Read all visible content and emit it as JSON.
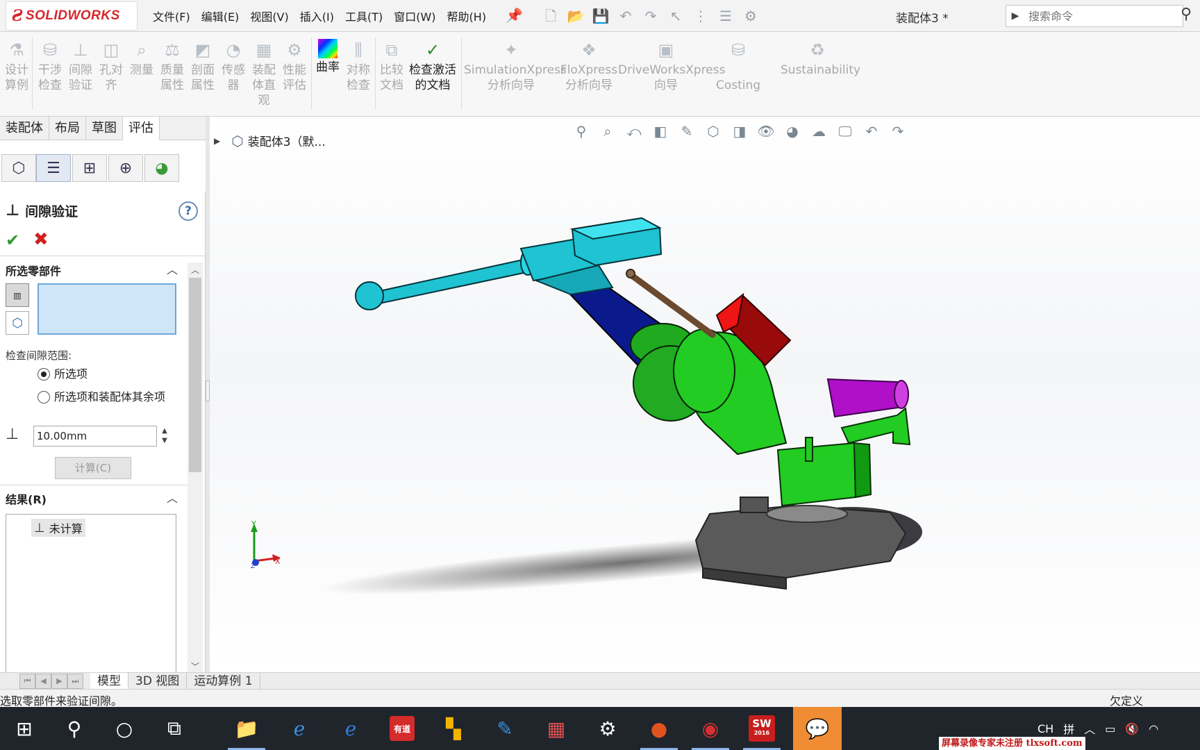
{
  "app": {
    "brand_ds": "Ƨ",
    "brand_name": "SOLIDWORKS",
    "doc_title": "装配体3 *"
  },
  "menu": [
    "文件(F)",
    "编辑(E)",
    "视图(V)",
    "插入(I)",
    "工具(T)",
    "窗口(W)",
    "帮助(H)"
  ],
  "search": {
    "placeholder": "搜索命令"
  },
  "ribbon": {
    "design_study": "设计\n算例",
    "interference": "干涉\n检查",
    "clearance": "间隙\n验证",
    "hole_align": "孔对\n齐",
    "measure": "测量",
    "mass_props": "质量\n属性",
    "section_props": "剖面\n属性",
    "sensor": "传感\n器",
    "asm_visual": "装配\n体直\n观",
    "perf_eval": "性能\n评估",
    "curvature": "曲率",
    "symmetry": "对称\n检查",
    "compare": "比较\n文档",
    "check_active": "检查激活\n的文档",
    "simxpress": "SimulationXpress\n分析向导",
    "floxpress": "FloXpress\n分析向导",
    "driveworks": "DriveWorksXpress\n向导",
    "costing": "Costing",
    "sustainability": "Sustainability"
  },
  "tabs": [
    "装配体",
    "布局",
    "草图",
    "评估"
  ],
  "property_manager": {
    "title": "间隙验证",
    "help": "?",
    "ok": "✔",
    "cancel": "✖",
    "selected_group": "所选零部件",
    "range_label": "检查间隙范围:",
    "radio_selected": "所选项",
    "radio_selected_rest": "所选项和装配体其余项",
    "distance_value": "10.00mm",
    "calculate": "计算(C)",
    "results_group": "结果(R)",
    "result_item": "未计算"
  },
  "tree": {
    "root": "装配体3（默..."
  },
  "triad": {
    "x": "X",
    "y": "Y",
    "z": "Z"
  },
  "bottom_tabs": [
    "模型",
    "3D 视图",
    "运动算例 1"
  ],
  "status": {
    "message": "选取零部件来验证间隙。",
    "definition": "欠定义"
  },
  "tray": {
    "ime_ch": "CH",
    "ime_pin": "拼",
    "taskbar_youdao": "有道",
    "sw_badge": "SW",
    "sw_version": "2016"
  },
  "watermark": "屏幕录像专家未注册 tlxsoft.com",
  "colors": {
    "accent": "#2a7fd8",
    "arm": "#1fc3d2",
    "link_blue": "#0a1a8c",
    "body_green": "#22cc22",
    "block_red": "#cc1010",
    "magenta": "#b010c8",
    "base_gray": "#5a5a5a",
    "taskbar": "#20242b"
  }
}
